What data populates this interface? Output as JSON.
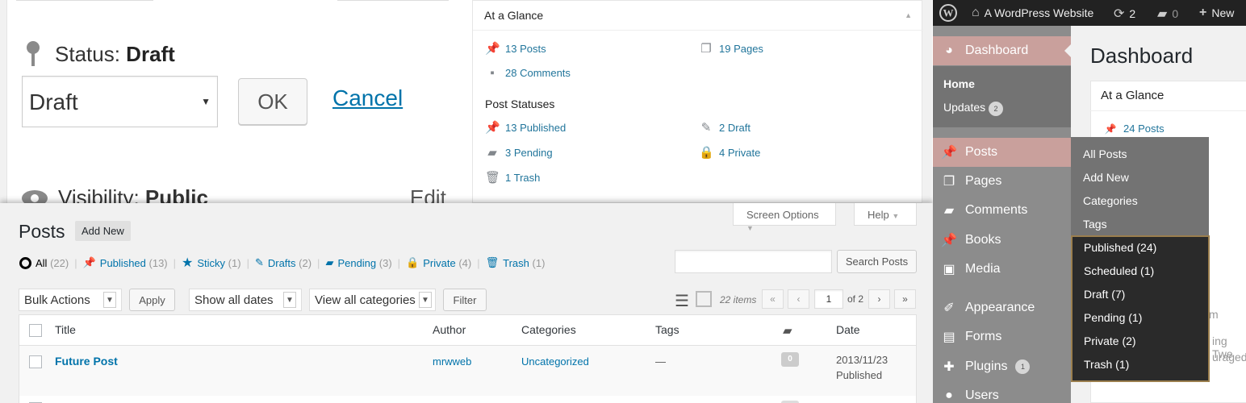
{
  "publish": {
    "status_label": "Status:",
    "status_value": "Draft",
    "select_value": "Draft",
    "ok_label": "OK",
    "cancel_label": "Cancel",
    "visibility_label": "Visibility:",
    "visibility_value": "Public",
    "edit_label": "Edit"
  },
  "glance": {
    "title": "At a Glance",
    "posts": "13 Posts",
    "pages": "19 Pages",
    "comments": "28 Comments",
    "statuses_title": "Post Statuses",
    "published": "13 Published",
    "draft": "2 Draft",
    "pending": "3 Pending",
    "private": "4 Private",
    "trash": "1 Trash"
  },
  "posts_list": {
    "title": "Posts",
    "add_new": "Add New",
    "screen_options": "Screen Options",
    "help": "Help",
    "filters": [
      {
        "label": "All",
        "count": "(22)"
      },
      {
        "label": "Published",
        "count": "(13)"
      },
      {
        "label": "Sticky",
        "count": "(1)"
      },
      {
        "label": "Drafts",
        "count": "(2)"
      },
      {
        "label": "Pending",
        "count": "(3)"
      },
      {
        "label": "Private",
        "count": "(4)"
      },
      {
        "label": "Trash",
        "count": "(1)"
      }
    ],
    "search_button": "Search Posts",
    "bulk_actions": "Bulk Actions",
    "apply": "Apply",
    "dates": "Show all dates",
    "categories": "View all categories",
    "filter": "Filter",
    "items": "22 items",
    "page_current": "1",
    "page_total": "of 2",
    "pager": {
      "first": "«",
      "prev": "‹",
      "next": "›",
      "last": "»"
    },
    "columns": {
      "title": "Title",
      "author": "Author",
      "categories": "Categories",
      "tags": "Tags",
      "date": "Date"
    },
    "row": {
      "title": "Future Post",
      "author": "mrwweb",
      "categories": "Uncategorized",
      "tags": "—",
      "comments": "0",
      "date": "2013/11/23",
      "status": "Published"
    }
  },
  "admin": {
    "site_name": "A WordPress Website",
    "updates_count": "2",
    "comments_count": "0",
    "new_label": "New",
    "page_title": "Dashboard",
    "glance_title": "At a Glance",
    "glance_posts": "24 Posts",
    "peek_1": "m",
    "peek_2": "ing Twe",
    "peek_3": "uraged",
    "menu": {
      "dashboard": "Dashboard",
      "home": "Home",
      "updates": "Updates",
      "updates_badge": "2",
      "posts": "Posts",
      "pages": "Pages",
      "comments": "Comments",
      "books": "Books",
      "media": "Media",
      "appearance": "Appearance",
      "forms": "Forms",
      "plugins": "Plugins",
      "plugins_badge": "1",
      "users": "Users"
    },
    "flyout": [
      "All Posts",
      "Add New",
      "Categories",
      "Tags"
    ],
    "flyout2": [
      "Published (24)",
      "Scheduled (1)",
      "Draft (7)",
      "Pending (1)",
      "Private (2)",
      "Trash (1)"
    ]
  }
}
